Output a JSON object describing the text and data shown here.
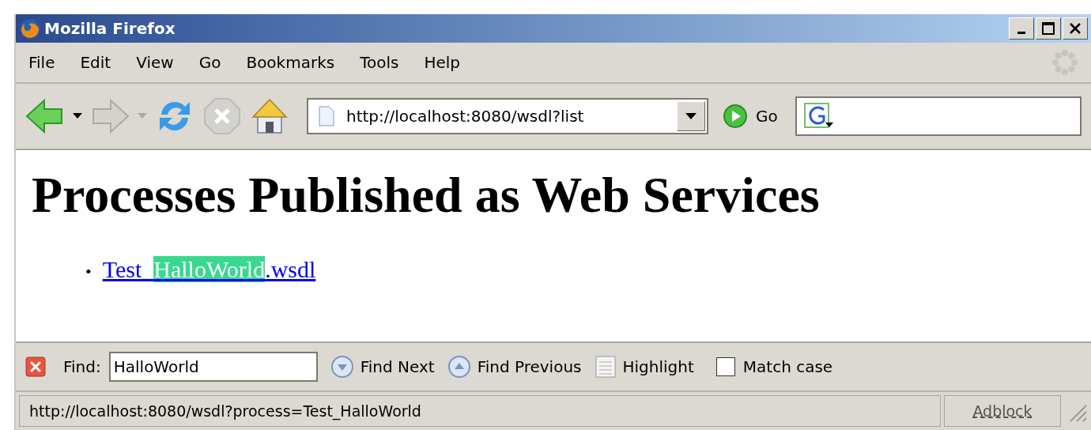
{
  "window": {
    "title": "Mozilla Firefox"
  },
  "menu": [
    "File",
    "Edit",
    "View",
    "Go",
    "Bookmarks",
    "Tools",
    "Help"
  ],
  "toolbar": {
    "address": "http://localhost:8080/wsdl?list",
    "go": "Go"
  },
  "page": {
    "heading": "Processes Published as Web Services",
    "links": [
      {
        "marker": "•",
        "segments": [
          {
            "text": "Test_",
            "highlighted": false
          },
          {
            "text": "HalloWorld",
            "highlighted": true
          },
          {
            "text": ".wsdl",
            "highlighted": false
          }
        ]
      }
    ]
  },
  "find_bar": {
    "label": "Find:",
    "value": "HalloWorld",
    "find_next": "Find Next",
    "find_previous": "Find Previous",
    "highlight": "Highlight",
    "match_case": {
      "label": "Match case",
      "checked": false
    }
  },
  "status_bar": {
    "text": "http://localhost:8080/wsdl?process=Test_HalloWorld",
    "panel": "Adblock"
  }
}
